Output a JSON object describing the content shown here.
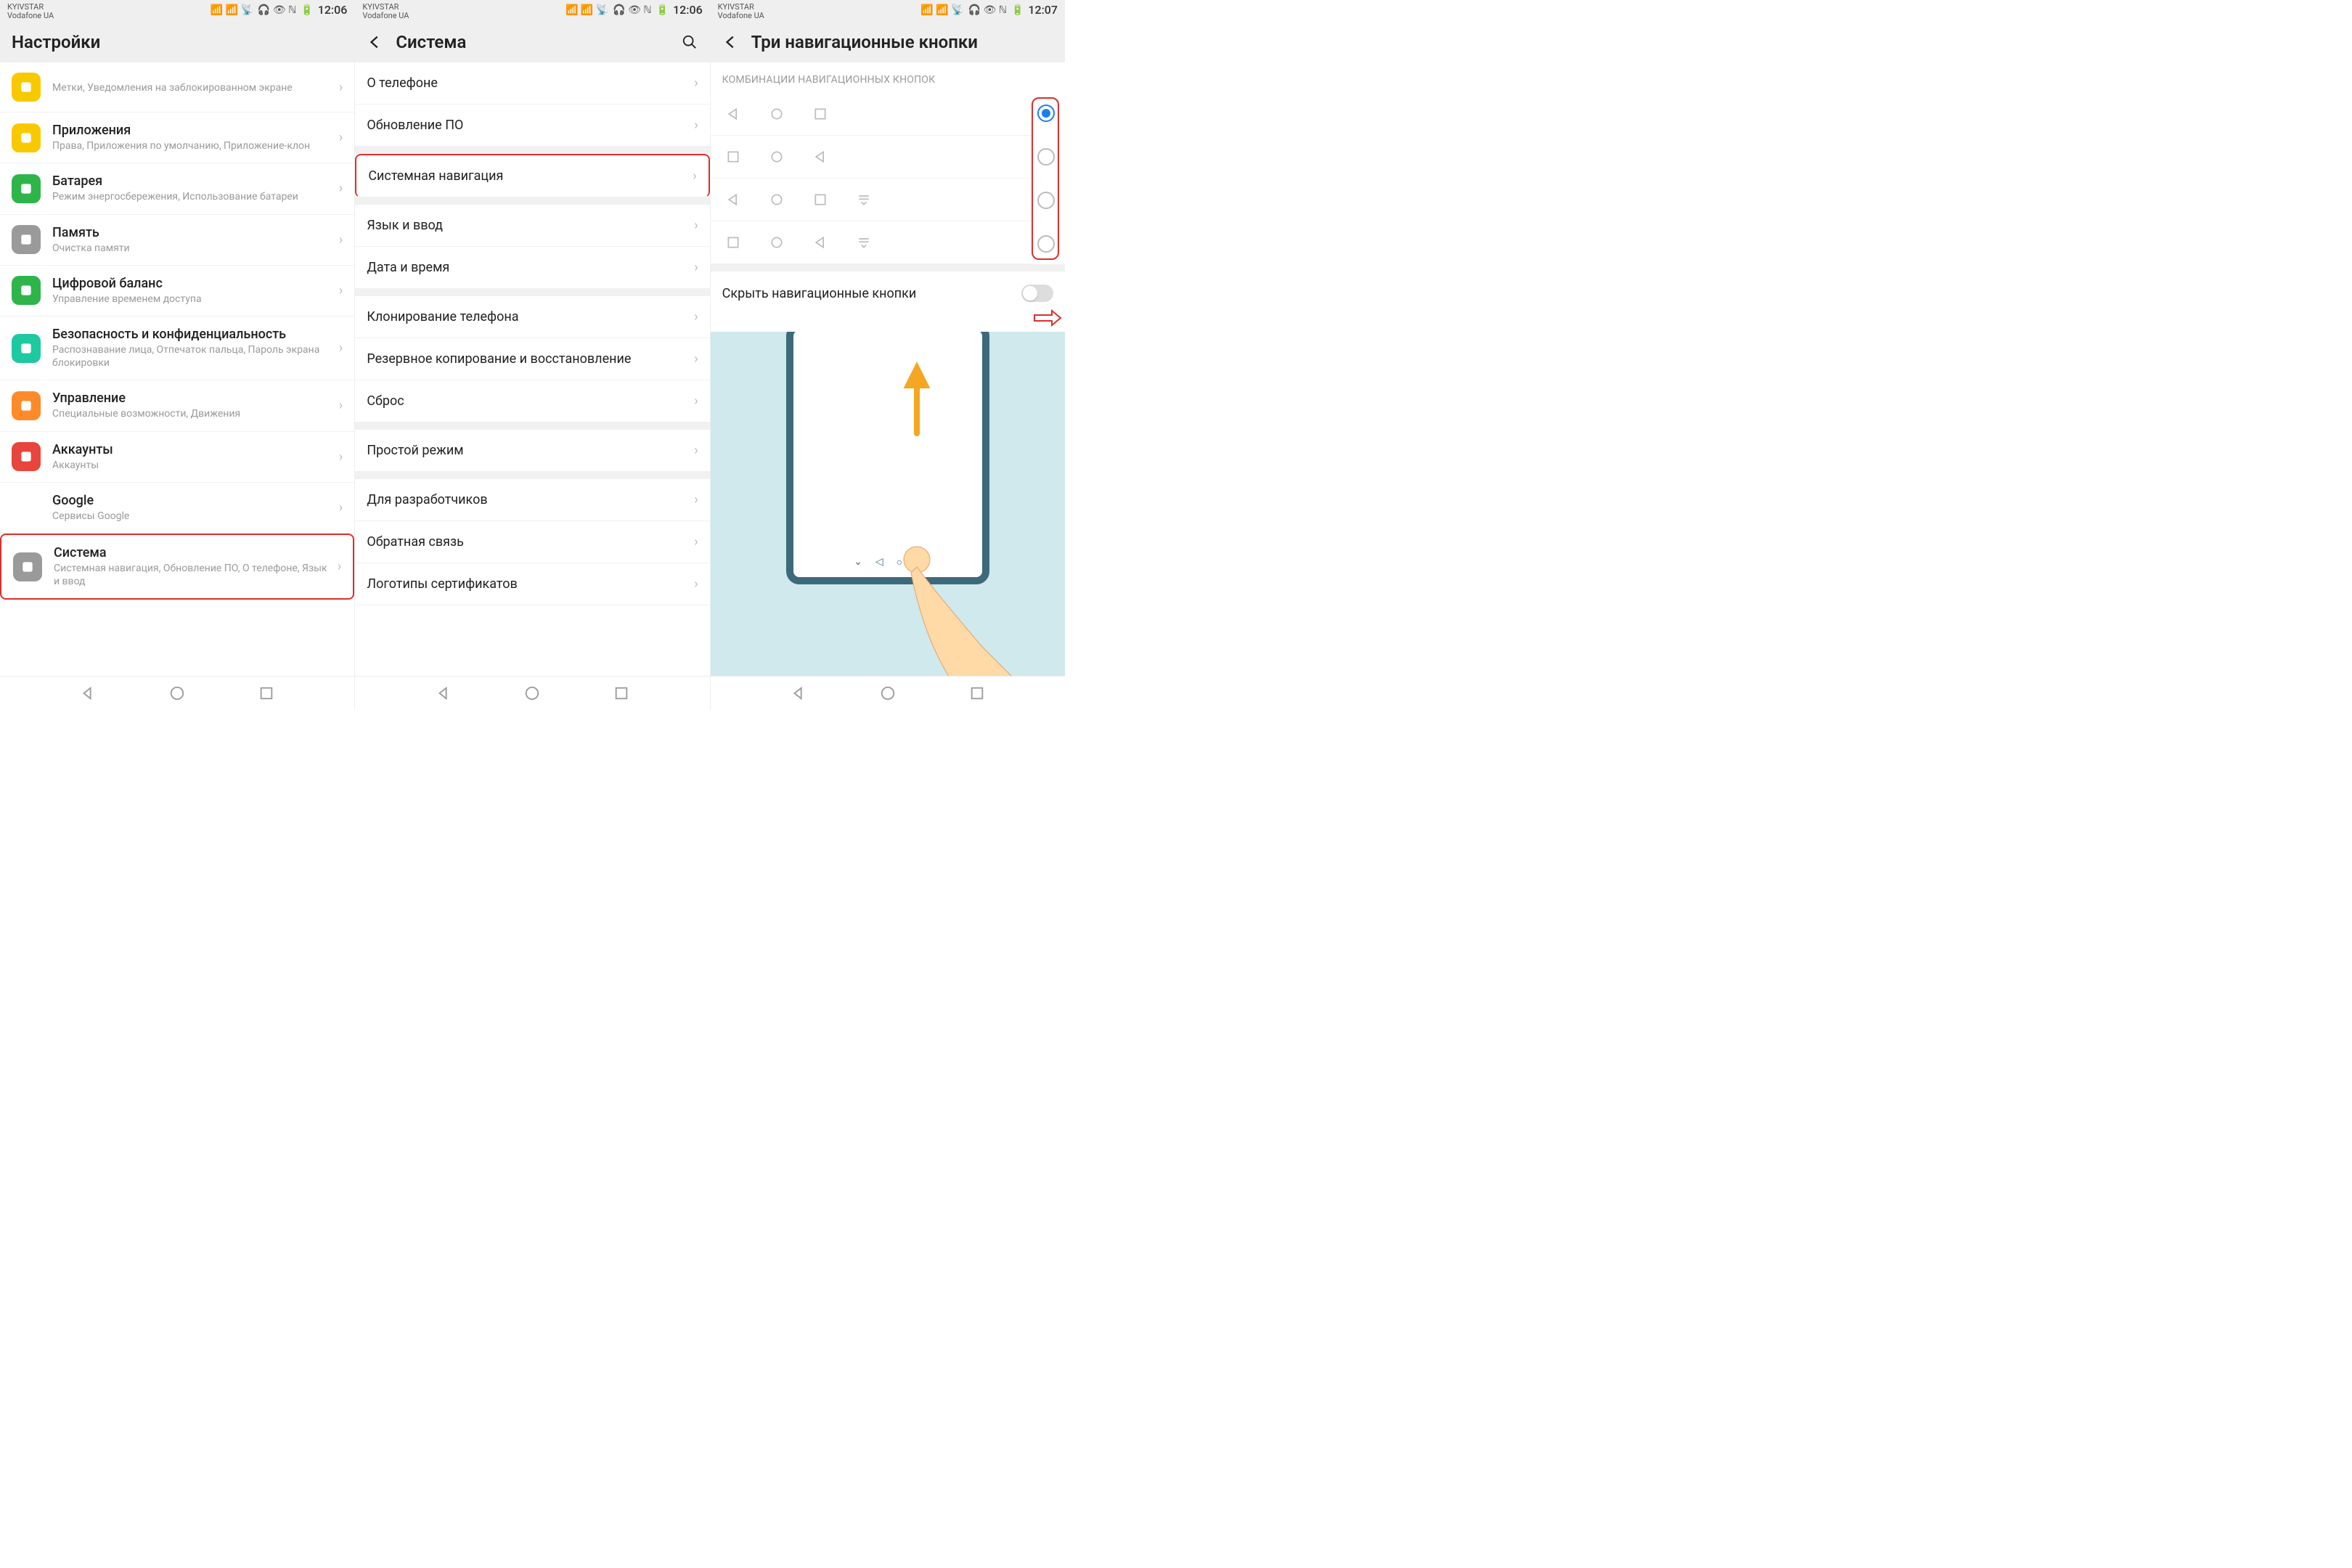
{
  "status": {
    "carrier1": "KYIVSTAR",
    "carrier2": "Vodafone UA",
    "time1": "12:06",
    "time2": "12:06",
    "time3": "12:07",
    "battery": "51"
  },
  "panel1": {
    "header": "Настройки",
    "items": [
      {
        "title": "",
        "sub": "Метки, Уведомления на заблокированном экране",
        "iconColor": "#f9c900"
      },
      {
        "title": "Приложения",
        "sub": "Права, Приложения по умолчанию, Приложение-клон",
        "iconColor": "#f9c900"
      },
      {
        "title": "Батарея",
        "sub": "Режим энергосбережения, Использование батареи",
        "iconColor": "#2eb54a"
      },
      {
        "title": "Память",
        "sub": "Очистка памяти",
        "iconColor": "#9a9a9a"
      },
      {
        "title": "Цифровой баланс",
        "sub": "Управление временем доступа",
        "iconColor": "#2eb54a"
      },
      {
        "title": "Безопасность и конфиденциальность",
        "sub": "Распознавание лица, Отпечаток пальца, Пароль экрана блокировки",
        "iconColor": "#1ec9a2"
      },
      {
        "title": "Управление",
        "sub": "Специальные возможности, Движения",
        "iconColor": "#ff8a2a"
      },
      {
        "title": "Аккаунты",
        "sub": "Аккаунты",
        "iconColor": "#e8453c"
      },
      {
        "title": "Google",
        "sub": "Сервисы Google",
        "iconColor": "#ffffff"
      },
      {
        "title": "Система",
        "sub": "Системная навигация, Обновление ПО, О телефоне, Язык и ввод",
        "iconColor": "#9a9a9a",
        "highlight": true
      }
    ]
  },
  "panel2": {
    "header": "Система",
    "groups": [
      [
        "О телефоне",
        "Обновление ПО"
      ],
      [
        "Системная навигация"
      ],
      [
        "Язык и ввод",
        "Дата и время"
      ],
      [
        "Клонирование телефона",
        "Резервное копирование и восстановление",
        "Сброс"
      ],
      [
        "Простой режим"
      ],
      [
        "Для разработчиков",
        "Обратная связь",
        "Логотипы сертификатов"
      ]
    ],
    "highlightIndex": 2
  },
  "panel3": {
    "header": "Три навигационные кнопки",
    "sectionLabel": "КОМБИНАЦИИ НАВИГАЦИОННЫХ КНОПОК",
    "combos": [
      {
        "icons": [
          "tri",
          "circ",
          "sq",
          ""
        ],
        "selected": true
      },
      {
        "icons": [
          "sq",
          "circ",
          "tri",
          ""
        ],
        "selected": false
      },
      {
        "icons": [
          "tri",
          "circ",
          "sq",
          "drop"
        ],
        "selected": false
      },
      {
        "icons": [
          "sq",
          "circ",
          "tri",
          "drop"
        ],
        "selected": false
      }
    ],
    "hideLabel": "Скрыть навигационные кнопки"
  }
}
